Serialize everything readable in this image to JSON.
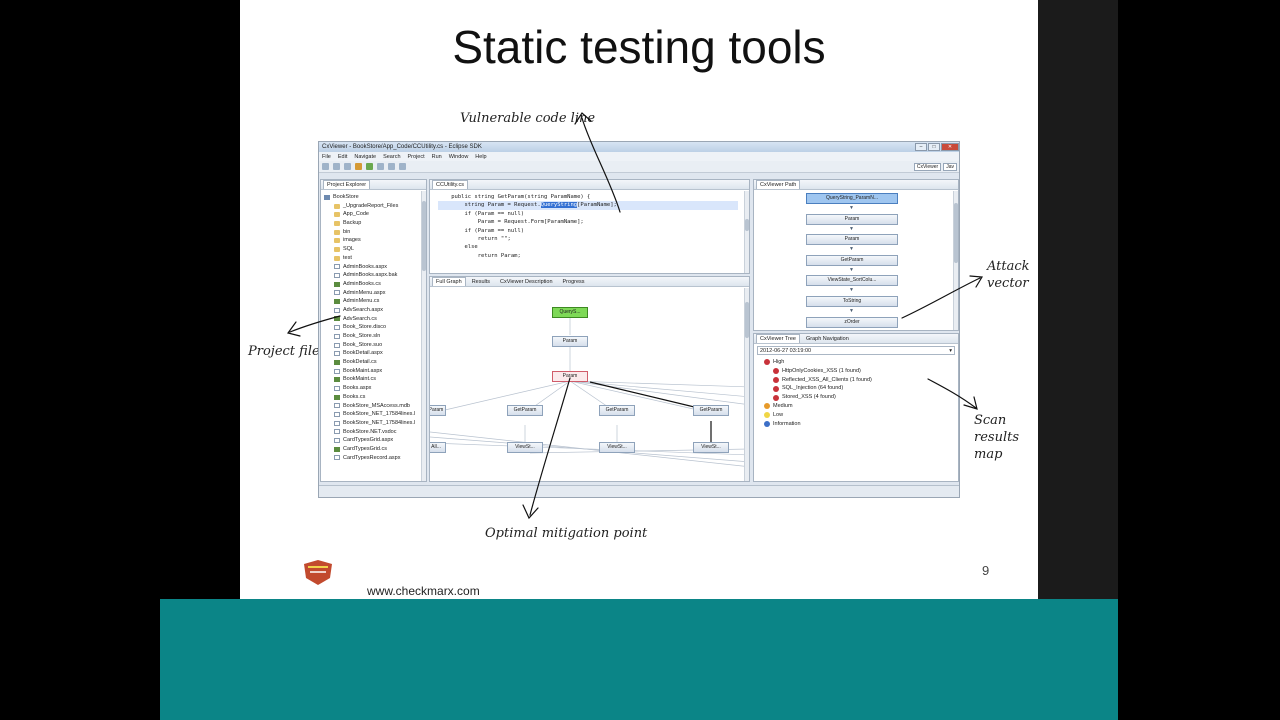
{
  "slide": {
    "title": "Static testing tools",
    "page_number": "9",
    "footer_url": "www.checkmarx.com"
  },
  "annotations": {
    "vulnerable_code_line": "Vulnerable code line",
    "project_files": "Project files",
    "attack_vector_1": "Attack",
    "attack_vector_2": "vector",
    "scan_results_1": "Scan",
    "scan_results_2": "results",
    "scan_results_3": "map",
    "optimal_mitigation": "Optimal mitigation point"
  },
  "eclipse": {
    "window_title": "CxViewer - BookStore/App_Code/CCUtility.cs - Eclipse SDK",
    "menu": [
      "File",
      "Edit",
      "Navigate",
      "Search",
      "Project",
      "Run",
      "Window",
      "Help"
    ],
    "perspectives": [
      "CxViewer",
      "Jav"
    ],
    "project_explorer": {
      "tab": "Project Explorer",
      "items": [
        {
          "label": "BookStore",
          "type": "root",
          "indent": 0
        },
        {
          "label": "_UpgradeReport_Files",
          "type": "folder",
          "indent": 1
        },
        {
          "label": "App_Code",
          "type": "folder",
          "indent": 1
        },
        {
          "label": "Backup",
          "type": "folder",
          "indent": 1
        },
        {
          "label": "bin",
          "type": "folder",
          "indent": 1
        },
        {
          "label": "images",
          "type": "folder",
          "indent": 1
        },
        {
          "label": "SQL",
          "type": "folder",
          "indent": 1
        },
        {
          "label": "test",
          "type": "folder",
          "indent": 1
        },
        {
          "label": "AdminBooks.aspx",
          "type": "file",
          "indent": 1
        },
        {
          "label": "AdminBooks.aspx.bak",
          "type": "file",
          "indent": 1
        },
        {
          "label": "AdminBooks.cs",
          "type": "cs",
          "indent": 1
        },
        {
          "label": "AdminMenu.aspx",
          "type": "file",
          "indent": 1
        },
        {
          "label": "AdminMenu.cs",
          "type": "cs",
          "indent": 1
        },
        {
          "label": "AdvSearch.aspx",
          "type": "file",
          "indent": 1
        },
        {
          "label": "AdvSearch.cs",
          "type": "cs",
          "indent": 1
        },
        {
          "label": "Book_Store.disco",
          "type": "file",
          "indent": 1
        },
        {
          "label": "Book_Store.sln",
          "type": "file",
          "indent": 1
        },
        {
          "label": "Book_Store.suo",
          "type": "file",
          "indent": 1
        },
        {
          "label": "BookDetail.aspx",
          "type": "file",
          "indent": 1
        },
        {
          "label": "BookDetail.cs",
          "type": "cs",
          "indent": 1
        },
        {
          "label": "BookMaint.aspx",
          "type": "file",
          "indent": 1
        },
        {
          "label": "BookMaint.cs",
          "type": "cs",
          "indent": 1
        },
        {
          "label": "Books.aspx",
          "type": "file",
          "indent": 1
        },
        {
          "label": "Books.cs",
          "type": "cs",
          "indent": 1
        },
        {
          "label": "BookStore_MSAccess.mdb",
          "type": "file",
          "indent": 1
        },
        {
          "label": "BookStore_NET_17584lines.l",
          "type": "file",
          "indent": 1
        },
        {
          "label": "BookStore_NET_17584lines.l",
          "type": "file",
          "indent": 1
        },
        {
          "label": "BookStore.NET.vsdoc",
          "type": "file",
          "indent": 1
        },
        {
          "label": "CardTypesGrid.aspx",
          "type": "file",
          "indent": 1
        },
        {
          "label": "CardTypesGrid.cs",
          "type": "cs",
          "indent": 1
        },
        {
          "label": "CardTypesRecord.aspx",
          "type": "file",
          "indent": 1
        }
      ]
    },
    "editor": {
      "tab": "CCUtility.cs",
      "lines": [
        "    public string GetParam(string ParamName) {",
        "        string Param = Request.QueryString[ParamName];",
        "        if (Param == null)",
        "            Param = Request.Form[ParamName];",
        "        if (Param == null)",
        "            return \"\";",
        "        else",
        "            return Param;"
      ],
      "selected_token": "QueryString"
    },
    "graph_tabs": [
      "Full Graph",
      "Results",
      "CxViewer Description",
      "Progress"
    ],
    "graph_nodes": {
      "top": "QueryS...",
      "param1": "Param",
      "param2": "Param",
      "left": "Param",
      "getparam1": "GetParam",
      "getparam2": "GetParam",
      "getparam3": "GetParam",
      "viewst1": "ViewSt...",
      "viewst2": "ViewSt...",
      "viewst3": "ViewSt...",
      "left_bottom": "All..."
    },
    "cx_path": {
      "tab": "CxViewer Path",
      "nodes": [
        "QueryString_ParamN...",
        "Param",
        "Param",
        "GetParam",
        "ViewState_SortColu...",
        "ToString",
        "zOrder"
      ]
    },
    "cx_tree": {
      "tabs": [
        "CxViewer Tree",
        "Graph Navigation"
      ],
      "scan_date": "2012-06-27 03:19:00",
      "levels": [
        {
          "label": "High",
          "severity": "red",
          "indent": 1
        },
        {
          "label": "HttpOnlyCookies_XSS (1 found)",
          "severity": "red",
          "indent": 2
        },
        {
          "label": "Reflected_XSS_All_Clients (1 found)",
          "severity": "red",
          "indent": 2
        },
        {
          "label": "SQL_Injection (64 found)",
          "severity": "red",
          "indent": 2
        },
        {
          "label": "Stored_XSS (4 found)",
          "severity": "red",
          "indent": 2
        },
        {
          "label": "Medium",
          "severity": "orange",
          "indent": 1
        },
        {
          "label": "Low",
          "severity": "yellow",
          "indent": 1
        },
        {
          "label": "Information",
          "severity": "blue",
          "indent": 1
        }
      ]
    }
  }
}
